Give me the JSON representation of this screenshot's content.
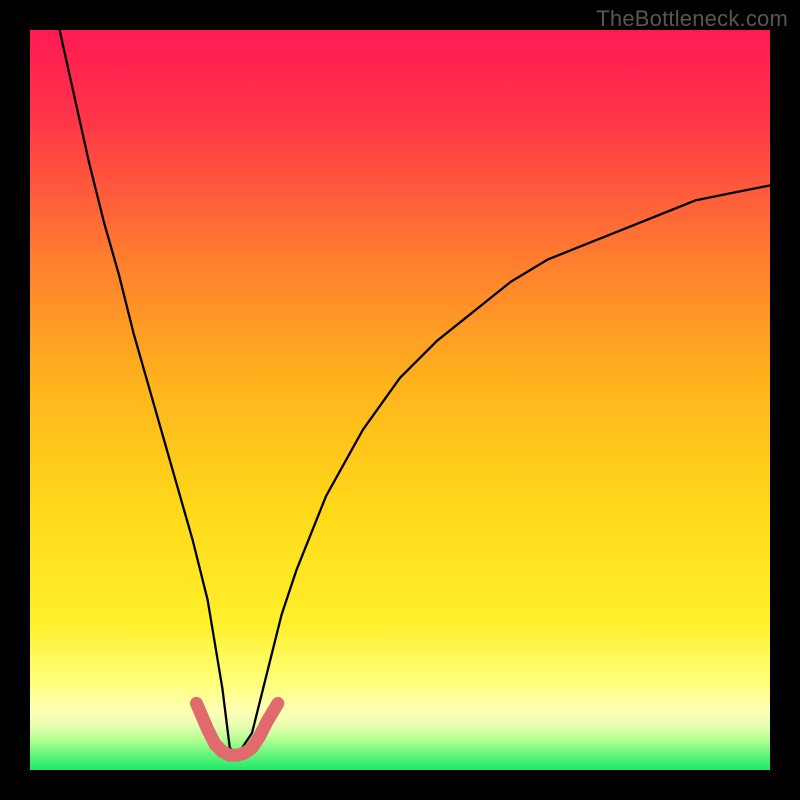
{
  "watermark": "TheBottleneck.com",
  "colors": {
    "frame": "#000000",
    "gradient_top": "#ff1a53",
    "gradient_mid": "#ffd700",
    "gradient_low_yellow": "#ffff9a",
    "gradient_green_band_top": "#d8ff90",
    "gradient_green": "#2af06e",
    "curve": "#000000",
    "salmon": "#e16a6e"
  },
  "chart_data": {
    "type": "line",
    "title": "",
    "xlabel": "",
    "ylabel": "",
    "xlim": [
      0,
      100
    ],
    "ylim": [
      0,
      100
    ],
    "series": [
      {
        "name": "black-curve",
        "x": [
          4,
          6,
          8,
          10,
          12,
          14,
          16,
          18,
          20,
          22,
          24,
          26,
          27,
          28,
          30,
          32,
          34,
          36,
          40,
          45,
          50,
          55,
          60,
          65,
          70,
          75,
          80,
          85,
          90,
          95,
          100
        ],
        "values": [
          100,
          91,
          82,
          74,
          67,
          59,
          52,
          45,
          38,
          31,
          23,
          11,
          3,
          2,
          5,
          13,
          21,
          27,
          37,
          46,
          53,
          58,
          62,
          66,
          69,
          71,
          73,
          75,
          77,
          78,
          79
        ]
      },
      {
        "name": "salmon-segment",
        "x": [
          22.5,
          24,
          25,
          26,
          27,
          28,
          29,
          30,
          31,
          32,
          33.5
        ],
        "values": [
          9,
          5.5,
          3.5,
          2.5,
          2,
          2,
          2.3,
          3,
          4.5,
          6.5,
          9
        ]
      }
    ],
    "annotations": []
  }
}
